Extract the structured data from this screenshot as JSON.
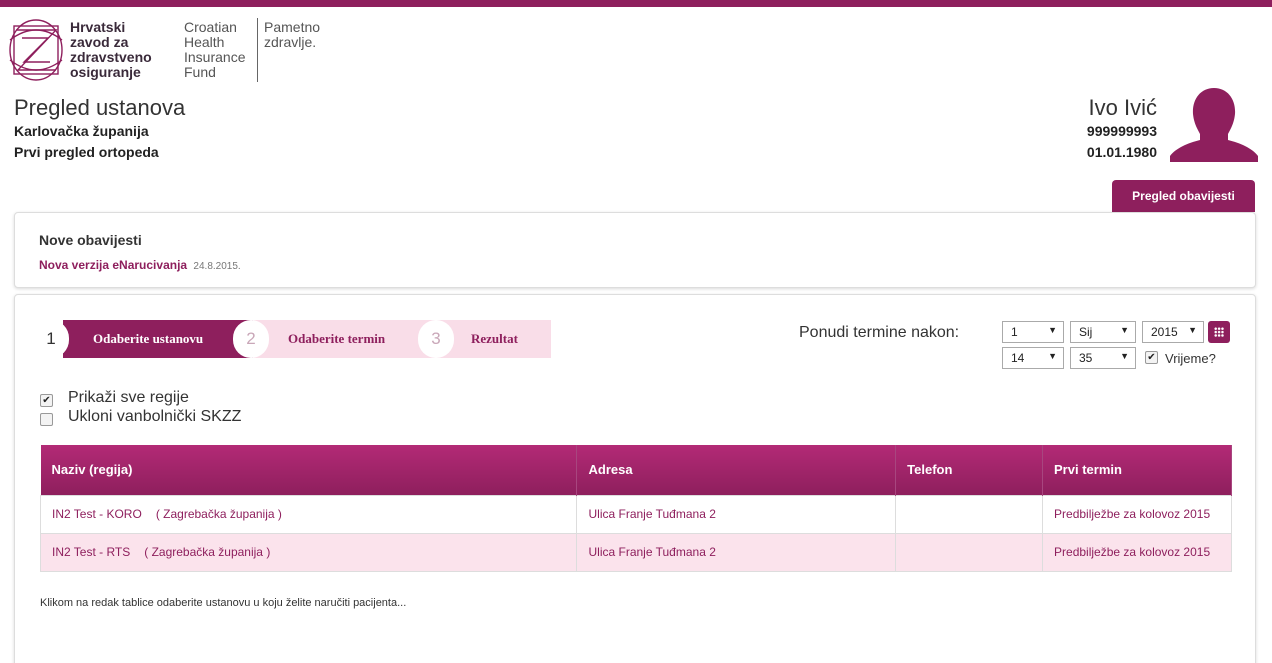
{
  "logo": {
    "hr_lines": [
      "Hrvatski",
      "zavod za",
      "zdravstveno",
      "osiguranje"
    ],
    "en_lines": [
      "Croatian",
      "Health",
      "Insurance",
      "Fund"
    ],
    "tagline_lines": [
      "Pametno",
      "zdravlje."
    ]
  },
  "header": {
    "title": "Pregled ustanova",
    "county": "Karlovačka županija",
    "exam": "Prvi pregled ortopeda"
  },
  "user": {
    "name": "Ivo Ivić",
    "id": "999999993",
    "dob": "01.01.1980"
  },
  "notifications_button": "Pregled obavijesti",
  "news": {
    "title": "Nove obavijesti",
    "link": "Nova verzija eNarucivanja",
    "date": "24.8.2015."
  },
  "steps": [
    {
      "num": "1",
      "label": "Odaberite ustanovu",
      "active": true
    },
    {
      "num": "2",
      "label": "Odaberite termin",
      "active": false
    },
    {
      "num": "3",
      "label": "Rezultat",
      "active": false
    }
  ],
  "offer": {
    "label": "Ponudi termine nakon:",
    "day": "1",
    "month": "Sij",
    "year": "2015",
    "hour": "14",
    "minute": "35",
    "time_label": "Vrijeme?",
    "time_checked": true
  },
  "options": [
    {
      "label": "Prikaži sve regije",
      "checked": true
    },
    {
      "label": "Ukloni vanbolnički SKZZ",
      "checked": false
    }
  ],
  "table": {
    "headers": [
      "Naziv (regija)",
      "Adresa",
      "Telefon",
      "Prvi termin"
    ],
    "rows": [
      {
        "name": "IN2 Test - KORO",
        "region": "( Zagrebačka županija )",
        "address": "Ulica Franje Tuđmana 2",
        "phone": "",
        "first": "Predbilježbe za kolovoz 2015"
      },
      {
        "name": "IN2 Test - RTS",
        "region": "( Zagrebačka županija )",
        "address": "Ulica Franje Tuđmana 2",
        "phone": "",
        "first": "Predbilježbe za kolovoz 2015"
      }
    ]
  },
  "hint": "Klikom na redak tablice odaberite ustanovu u koju želite naručiti pacijenta...",
  "colors": {
    "brand": "#8e1f5d",
    "row_alt": "#fbe3ec",
    "step_inactive": "#f9dde8"
  }
}
